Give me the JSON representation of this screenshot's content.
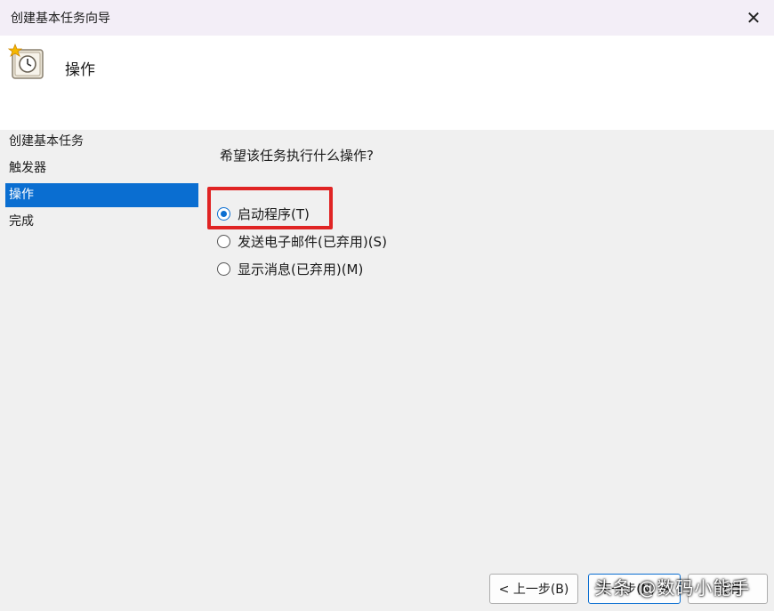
{
  "window": {
    "title": "创建基本任务向导",
    "close_glyph": "✕"
  },
  "header": {
    "heading": "操作",
    "icon": "task-clock-icon"
  },
  "sidebar": {
    "items": [
      {
        "label": "创建基本任务"
      },
      {
        "label": "触发器"
      },
      {
        "label": "操作"
      },
      {
        "label": "完成"
      }
    ],
    "active_index": 2
  },
  "main": {
    "question": "希望该任务执行什么操作?",
    "options": [
      {
        "label": "启动程序(T)",
        "selected": true
      },
      {
        "label": "发送电子邮件(已弃用)(S)",
        "selected": false
      },
      {
        "label": "显示消息(已弃用)(M)",
        "selected": false
      }
    ]
  },
  "buttons": {
    "back": "< 上一步(B)",
    "next": "下一步(N) >",
    "cancel": "取消"
  },
  "watermark": "头条 @数码小能手",
  "colors": {
    "accent": "#0a6ed1",
    "highlight": "#e02424"
  }
}
